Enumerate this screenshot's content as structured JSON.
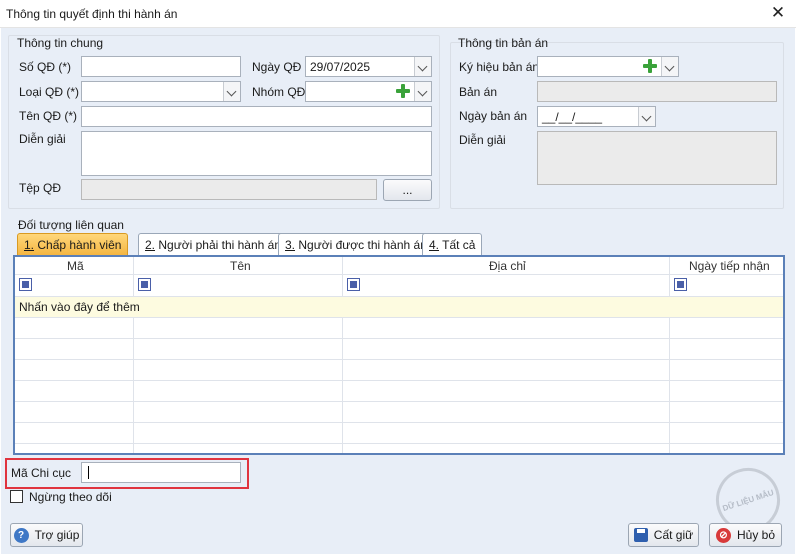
{
  "window": {
    "title": "Thông tin quyết định thi hành án",
    "close_glyph": "✕"
  },
  "general": {
    "group_title": "Thông tin chung",
    "so_qd_label": "Số QĐ (*)",
    "ngay_qd_label": "Ngày QĐ",
    "ngay_qd_value": "29/07/2025",
    "loai_qd_label": "Loại QĐ (*)",
    "nhom_qd_label": "Nhóm QĐ",
    "ten_qd_label": "Tên QĐ (*)",
    "dien_giai_label": "Diễn giải",
    "tep_qd_label": "Tệp QĐ",
    "browse_label": "..."
  },
  "judgment": {
    "group_title": "Thông tin bản án",
    "ky_hieu_label": "Ký hiệu bản án",
    "ban_an_label": "Bản án",
    "ngay_ban_an_label": "Ngày bản án",
    "ngay_ban_an_value": "__/__/____",
    "dien_giai_label": "Diễn giải"
  },
  "related": {
    "group_title": "Đối tượng liên quan",
    "tabs": [
      {
        "num": "1.",
        "label": " Chấp hành viên"
      },
      {
        "num": "2.",
        "label": " Người phải thi hành án"
      },
      {
        "num": "3.",
        "label": " Người được thi hành án"
      },
      {
        "num": "4.",
        "label": " Tất cả"
      }
    ],
    "columns": [
      "Mã",
      "Tên",
      "Địa chỉ",
      "Ngày tiếp nhận"
    ],
    "new_row_prompt": "Nhấn vào đây để thêm"
  },
  "ma_chi_cuc_label": "Mã Chi cục",
  "ma_chi_cuc_value": "",
  "ngung_theo_doi_label": "Ngừng theo dõi",
  "watermark_text": "DỮ LIỆU MẪU",
  "buttons": {
    "help": "Trợ giúp",
    "save": "Cất giữ",
    "cancel": "Hủy bỏ"
  },
  "colors": {
    "accent_tab": "#f4b642",
    "grid_border": "#5b80b8",
    "highlight": "#e0343f"
  }
}
